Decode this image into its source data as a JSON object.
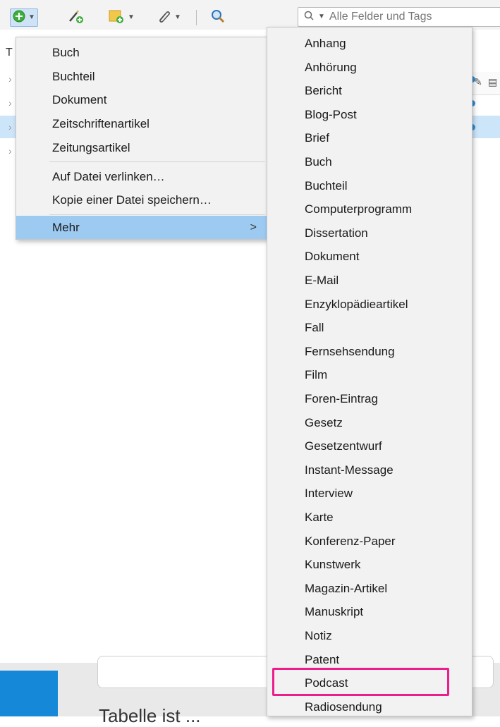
{
  "toolbar": {
    "search_placeholder": "Alle Felder und Tags"
  },
  "list": {
    "header_initial": "T"
  },
  "new_item_menu": {
    "items": [
      "Buch",
      "Buchteil",
      "Dokument",
      "Zeitschriftenartikel",
      "Zeitungsartikel"
    ],
    "attach_link": "Auf Datei verlinken…",
    "attach_copy": "Kopie einer Datei speichern…",
    "more": "Mehr",
    "more_arrow": ">"
  },
  "more_menu": {
    "items": [
      "Anhang",
      "Anhörung",
      "Bericht",
      "Blog-Post",
      "Brief",
      "Buch",
      "Buchteil",
      "Computerprogramm",
      "Dissertation",
      "Dokument",
      "E-Mail",
      "Enzyklopädieartikel",
      "Fall",
      "Fernsehsendung",
      "Film",
      "Foren-Eintrag",
      "Gesetz",
      "Gesetzentwurf",
      "Instant-Message",
      "Interview",
      "Karte",
      "Konferenz-Paper",
      "Kunstwerk",
      "Magazin-Artikel",
      "Manuskript",
      "Notiz",
      "Patent",
      "Podcast",
      "Radiosendung"
    ],
    "highlighted_item": "Podcast",
    "highlight_color": "#ec1e8c"
  },
  "footer": {
    "partial_text": "Tabelle ist ..."
  },
  "colors": {
    "menu_bg": "#f2f2f2",
    "menu_hover": "#9ccaf1",
    "selected_row": "#cde5f9",
    "accent_blue": "#1688d8"
  }
}
